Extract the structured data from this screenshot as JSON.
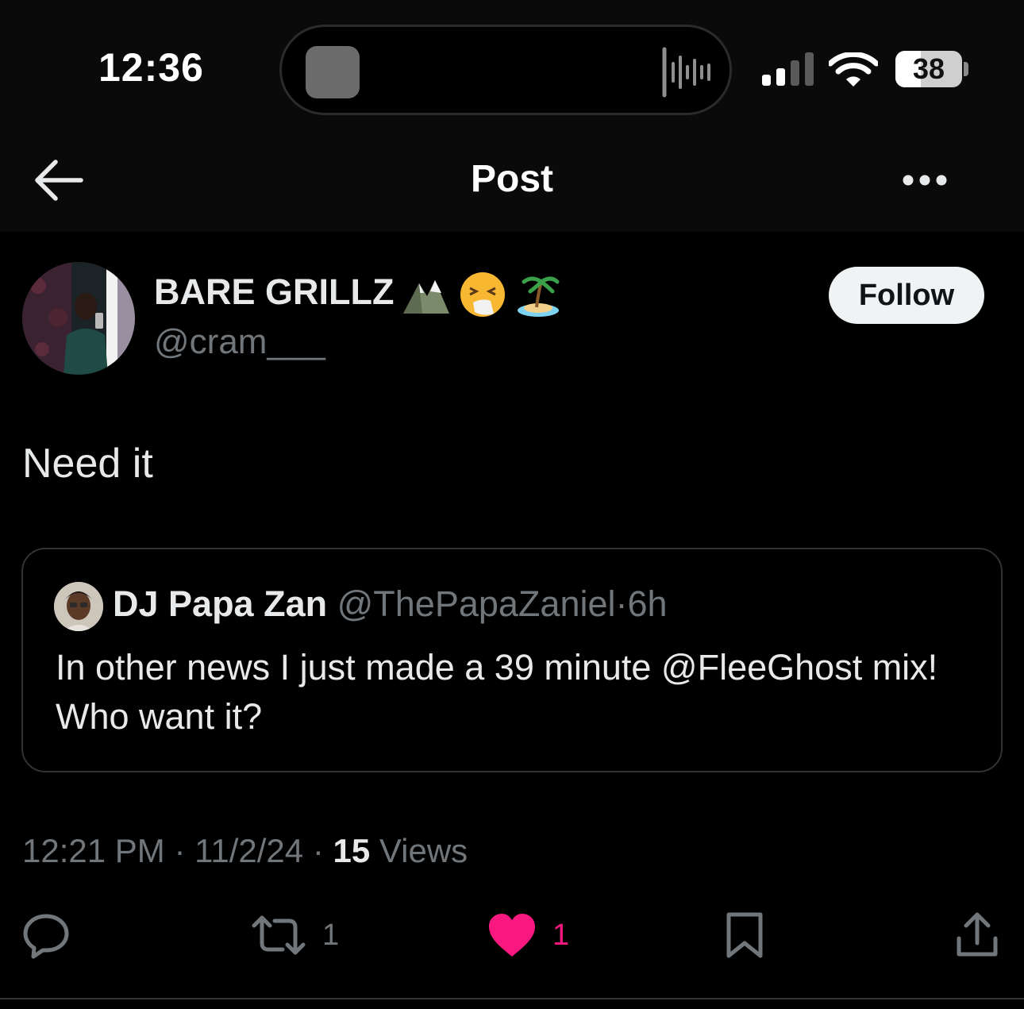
{
  "status_bar": {
    "time": "12:36",
    "battery_percent": "38",
    "battery_level": 0.38,
    "signal_bars_active": 2,
    "icons": [
      "live-activity-icon",
      "audio-wave-icon",
      "cellular-signal-icon",
      "wifi-icon",
      "battery-icon"
    ]
  },
  "nav": {
    "title": "Post",
    "back_icon": "arrow-left-icon",
    "more_icon": "more-horizontal-icon"
  },
  "post": {
    "author_name": "BARE GRILLZ",
    "author_emojis": [
      "mountain-emoji",
      "sneezing-face-emoji",
      "desert-island-emoji"
    ],
    "author_handle": "@cram___",
    "follow_label": "Follow",
    "text": "Need it",
    "timestamp": "12:21 PM",
    "date": "11/2/24",
    "separator": "·",
    "views_count": "15",
    "views_label": "Views"
  },
  "quote": {
    "name": "DJ Papa Zan",
    "handle": "@ThePapaZaniel",
    "separator": "·",
    "time": "6h",
    "text": "In other news I just made a 39 minute @FleeGhost mix! Who want it?"
  },
  "actions": {
    "reply_icon": "reply-icon",
    "repost_icon": "repost-icon",
    "repost_count": "1",
    "like_icon": "heart-filled-icon",
    "like_count": "1",
    "bookmark_icon": "bookmark-icon",
    "share_icon": "share-icon"
  },
  "colors": {
    "background": "#000000",
    "text_primary": "#e7e9ea",
    "text_secondary": "#71767b",
    "like": "#f91880",
    "border": "#2f3336",
    "follow_bg": "#eff3f4"
  }
}
